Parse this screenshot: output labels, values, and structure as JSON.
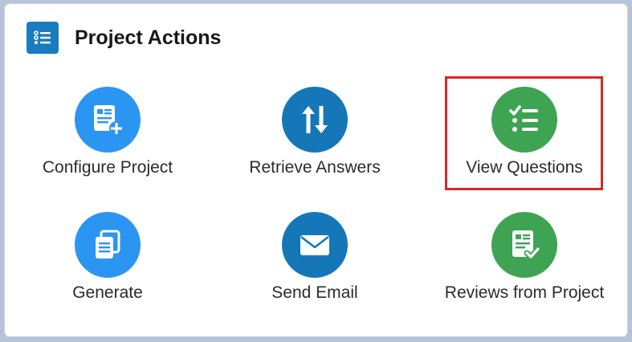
{
  "card": {
    "title": "Project Actions",
    "icon": "list-icon"
  },
  "actions": [
    {
      "label": "Configure Project",
      "icon": "form-add-icon",
      "color": "#2b95f2"
    },
    {
      "label": "Retrieve Answers",
      "icon": "sort-arrows-icon",
      "color": "#1577b8"
    },
    {
      "label": "View Questions",
      "icon": "checklist-icon",
      "color": "#3ea453",
      "highlighted": true
    },
    {
      "label": "Generate",
      "icon": "copy-documents-icon",
      "color": "#2b95f2"
    },
    {
      "label": "Send Email",
      "icon": "envelope-icon",
      "color": "#1577b8"
    },
    {
      "label": "Reviews from Project",
      "icon": "document-check-icon",
      "color": "#3ea453"
    }
  ],
  "colors": {
    "highlight_border": "#d22a2a",
    "header_icon_bg": "#1b7bbf"
  }
}
